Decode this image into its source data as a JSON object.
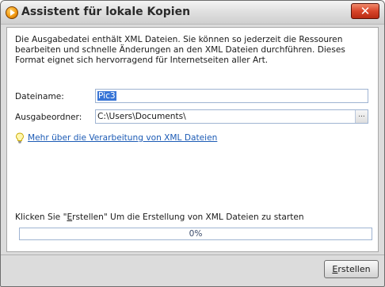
{
  "window": {
    "title": "Assistent für lokale Kopien",
    "close_symbol": "✕"
  },
  "description": "Die Ausgabedatei enthält XML Dateien. Sie können so jederzeit die Ressouren bearbeiten und schnelle Änderungen an den XML Dateien durchführen. Dieses Format eignet sich hervorragend für Internetseiten aller Art.",
  "form": {
    "filename_label": "Dateiname:",
    "filename_value": "Pic3",
    "output_label": "Ausgabeordner:",
    "output_value": "C:\\Users\\Documents\\",
    "browse_symbol": "..."
  },
  "hint": {
    "icon": "lightbulb-icon",
    "link_text": "Mehr über die Verarbeitung von XML Dateien"
  },
  "status": {
    "text_prefix": "Klicken Sie \"",
    "text_accel": "E",
    "text_suffix": "rstellen\" Um die Erstellung von XML Dateien zu starten",
    "progress_label": "0%",
    "progress_value": 0
  },
  "footer": {
    "create_accel": "E",
    "create_rest": "rstellen"
  },
  "colors": {
    "accent": "#3875d7",
    "link": "#1c5bb5",
    "close": "#d8452a"
  }
}
